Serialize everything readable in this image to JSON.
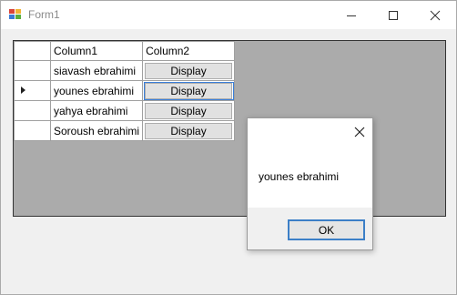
{
  "window": {
    "title": "Form1",
    "controls": {
      "minimize": "minimize",
      "maximize": "maximize",
      "close": "close"
    }
  },
  "grid": {
    "columns": [
      "Column1",
      "Column2"
    ],
    "rows": [
      {
        "name": "siavash ebrahimi",
        "button": "Display",
        "current": false
      },
      {
        "name": "younes ebrahimi",
        "button": "Display",
        "current": true
      },
      {
        "name": "yahya ebrahimi",
        "button": "Display",
        "current": false
      },
      {
        "name": "Soroush ebrahimi",
        "button": "Display",
        "current": false
      }
    ]
  },
  "dialog": {
    "message": "younes ebrahimi",
    "ok_label": "OK"
  },
  "colors": {
    "accent": "#3c7fc7",
    "grid_background": "#ababab",
    "button_face": "#e1e1e1"
  }
}
